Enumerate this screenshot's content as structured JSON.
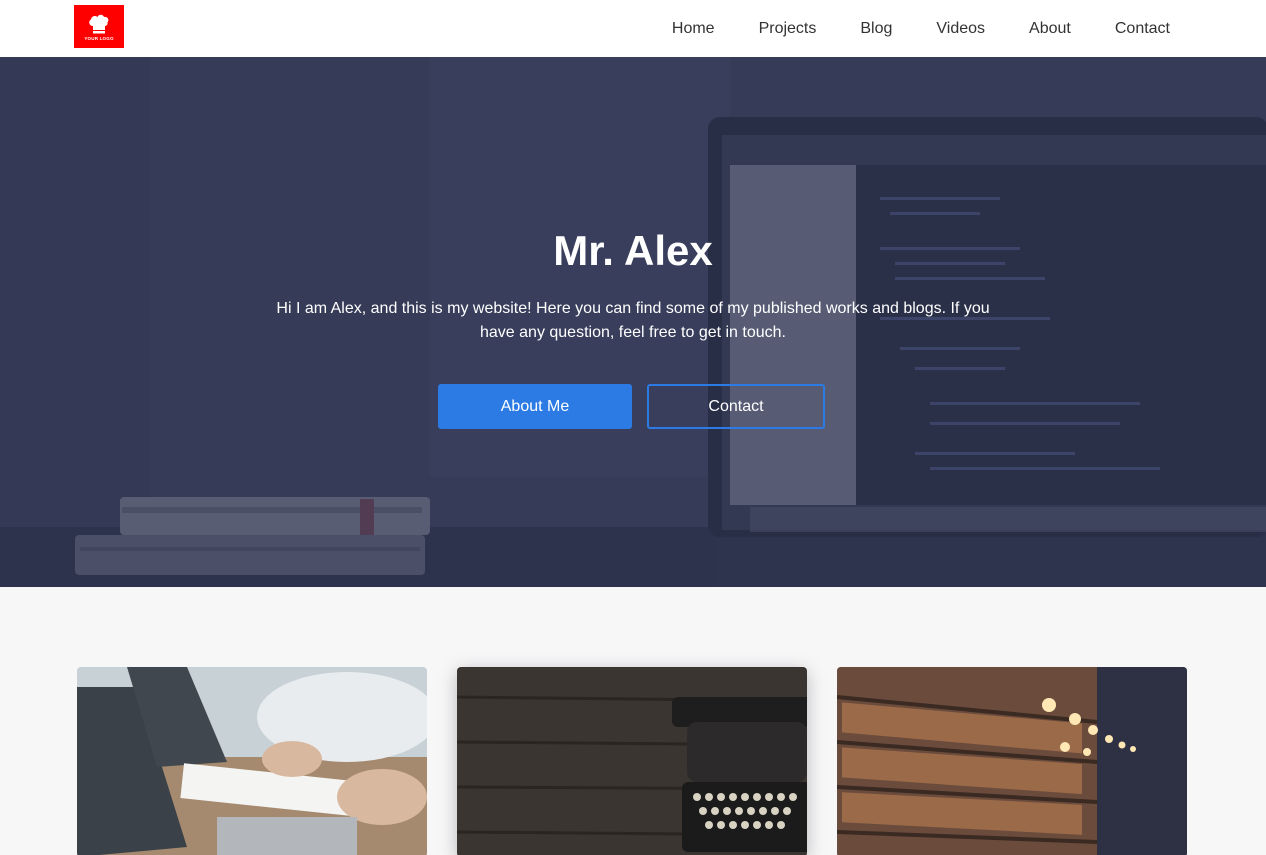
{
  "logo": {
    "text": "YOUR LOGO",
    "bg_color": "#ff0000"
  },
  "nav": {
    "items": [
      {
        "label": "Home"
      },
      {
        "label": "Projects"
      },
      {
        "label": "Blog"
      },
      {
        "label": "Videos"
      },
      {
        "label": "About"
      },
      {
        "label": "Contact"
      }
    ]
  },
  "hero": {
    "title": "Mr. Alex",
    "text": "Hi I am Alex, and this is my website! Here you can find some of my published works and blogs. If you have any question, feel free to get in touch.",
    "primary_button": "About Me",
    "secondary_button": "Contact",
    "accent_color": "#2c7be5"
  },
  "cards": [
    {
      "image": "laptops-meeting-photo"
    },
    {
      "image": "typewriter-on-wood-photo"
    },
    {
      "image": "library-bookshelves-photo"
    }
  ]
}
